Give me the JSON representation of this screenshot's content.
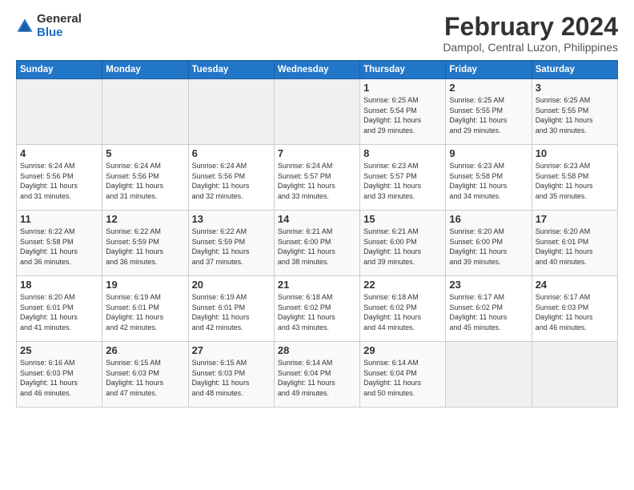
{
  "logo": {
    "general": "General",
    "blue": "Blue"
  },
  "title": "February 2024",
  "location": "Dampol, Central Luzon, Philippines",
  "days_header": [
    "Sunday",
    "Monday",
    "Tuesday",
    "Wednesday",
    "Thursday",
    "Friday",
    "Saturday"
  ],
  "weeks": [
    [
      {
        "num": "",
        "detail": ""
      },
      {
        "num": "",
        "detail": ""
      },
      {
        "num": "",
        "detail": ""
      },
      {
        "num": "",
        "detail": ""
      },
      {
        "num": "1",
        "detail": "Sunrise: 6:25 AM\nSunset: 5:54 PM\nDaylight: 11 hours\nand 29 minutes."
      },
      {
        "num": "2",
        "detail": "Sunrise: 6:25 AM\nSunset: 5:55 PM\nDaylight: 11 hours\nand 29 minutes."
      },
      {
        "num": "3",
        "detail": "Sunrise: 6:25 AM\nSunset: 5:55 PM\nDaylight: 11 hours\nand 30 minutes."
      }
    ],
    [
      {
        "num": "4",
        "detail": "Sunrise: 6:24 AM\nSunset: 5:56 PM\nDaylight: 11 hours\nand 31 minutes."
      },
      {
        "num": "5",
        "detail": "Sunrise: 6:24 AM\nSunset: 5:56 PM\nDaylight: 11 hours\nand 31 minutes."
      },
      {
        "num": "6",
        "detail": "Sunrise: 6:24 AM\nSunset: 5:56 PM\nDaylight: 11 hours\nand 32 minutes."
      },
      {
        "num": "7",
        "detail": "Sunrise: 6:24 AM\nSunset: 5:57 PM\nDaylight: 11 hours\nand 33 minutes."
      },
      {
        "num": "8",
        "detail": "Sunrise: 6:23 AM\nSunset: 5:57 PM\nDaylight: 11 hours\nand 33 minutes."
      },
      {
        "num": "9",
        "detail": "Sunrise: 6:23 AM\nSunset: 5:58 PM\nDaylight: 11 hours\nand 34 minutes."
      },
      {
        "num": "10",
        "detail": "Sunrise: 6:23 AM\nSunset: 5:58 PM\nDaylight: 11 hours\nand 35 minutes."
      }
    ],
    [
      {
        "num": "11",
        "detail": "Sunrise: 6:22 AM\nSunset: 5:58 PM\nDaylight: 11 hours\nand 36 minutes."
      },
      {
        "num": "12",
        "detail": "Sunrise: 6:22 AM\nSunset: 5:59 PM\nDaylight: 11 hours\nand 36 minutes."
      },
      {
        "num": "13",
        "detail": "Sunrise: 6:22 AM\nSunset: 5:59 PM\nDaylight: 11 hours\nand 37 minutes."
      },
      {
        "num": "14",
        "detail": "Sunrise: 6:21 AM\nSunset: 6:00 PM\nDaylight: 11 hours\nand 38 minutes."
      },
      {
        "num": "15",
        "detail": "Sunrise: 6:21 AM\nSunset: 6:00 PM\nDaylight: 11 hours\nand 39 minutes."
      },
      {
        "num": "16",
        "detail": "Sunrise: 6:20 AM\nSunset: 6:00 PM\nDaylight: 11 hours\nand 39 minutes."
      },
      {
        "num": "17",
        "detail": "Sunrise: 6:20 AM\nSunset: 6:01 PM\nDaylight: 11 hours\nand 40 minutes."
      }
    ],
    [
      {
        "num": "18",
        "detail": "Sunrise: 6:20 AM\nSunset: 6:01 PM\nDaylight: 11 hours\nand 41 minutes."
      },
      {
        "num": "19",
        "detail": "Sunrise: 6:19 AM\nSunset: 6:01 PM\nDaylight: 11 hours\nand 42 minutes."
      },
      {
        "num": "20",
        "detail": "Sunrise: 6:19 AM\nSunset: 6:01 PM\nDaylight: 11 hours\nand 42 minutes."
      },
      {
        "num": "21",
        "detail": "Sunrise: 6:18 AM\nSunset: 6:02 PM\nDaylight: 11 hours\nand 43 minutes."
      },
      {
        "num": "22",
        "detail": "Sunrise: 6:18 AM\nSunset: 6:02 PM\nDaylight: 11 hours\nand 44 minutes."
      },
      {
        "num": "23",
        "detail": "Sunrise: 6:17 AM\nSunset: 6:02 PM\nDaylight: 11 hours\nand 45 minutes."
      },
      {
        "num": "24",
        "detail": "Sunrise: 6:17 AM\nSunset: 6:03 PM\nDaylight: 11 hours\nand 46 minutes."
      }
    ],
    [
      {
        "num": "25",
        "detail": "Sunrise: 6:16 AM\nSunset: 6:03 PM\nDaylight: 11 hours\nand 46 minutes."
      },
      {
        "num": "26",
        "detail": "Sunrise: 6:15 AM\nSunset: 6:03 PM\nDaylight: 11 hours\nand 47 minutes."
      },
      {
        "num": "27",
        "detail": "Sunrise: 6:15 AM\nSunset: 6:03 PM\nDaylight: 11 hours\nand 48 minutes."
      },
      {
        "num": "28",
        "detail": "Sunrise: 6:14 AM\nSunset: 6:04 PM\nDaylight: 11 hours\nand 49 minutes."
      },
      {
        "num": "29",
        "detail": "Sunrise: 6:14 AM\nSunset: 6:04 PM\nDaylight: 11 hours\nand 50 minutes."
      },
      {
        "num": "",
        "detail": ""
      },
      {
        "num": "",
        "detail": ""
      }
    ]
  ]
}
